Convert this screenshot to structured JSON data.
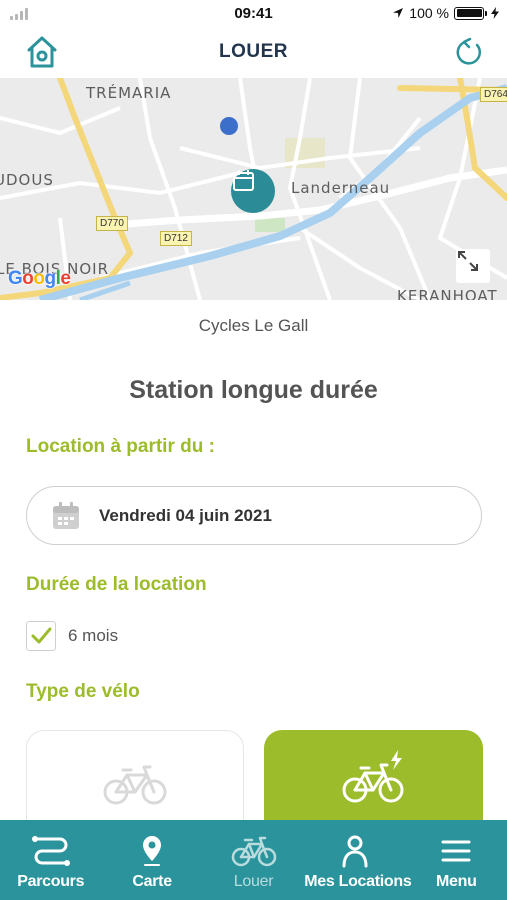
{
  "status_bar": {
    "time": "09:41",
    "battery": "100 %",
    "icons": [
      "signal-icon",
      "location-arrow-icon",
      "battery-icon",
      "charging-bolt-icon"
    ]
  },
  "header": {
    "title": "LOUER",
    "left_icon": "home-icon",
    "right_icon": "refresh-icon"
  },
  "map": {
    "labels": [
      "TRÉMARIA",
      "UDOUS",
      "Landerneau",
      "LE BOIS NOIR",
      "KERANHOAT"
    ],
    "road_tags": [
      "D770",
      "D712",
      "D764"
    ],
    "attribution": "Google",
    "marker_icon": "calendar-marker-icon",
    "expand_icon": "expand-icon"
  },
  "station": {
    "shop_name": "Cycles Le Gall",
    "title": "Station longue durée"
  },
  "form": {
    "start_label": "Location à partir du :",
    "start_date": "Vendredi 04 juin 2021",
    "duration_label": "Durée de la location",
    "duration_option": "6 mois",
    "duration_checked": true,
    "bike_type_label": "Type de vélo",
    "bike_types": [
      {
        "icon": "bike-icon",
        "selected": false
      },
      {
        "icon": "electric-bike-icon",
        "selected": true
      }
    ]
  },
  "tabs": [
    {
      "label": "Parcours",
      "icon": "route-icon",
      "active": false
    },
    {
      "label": "Carte",
      "icon": "map-pin-icon",
      "active": false
    },
    {
      "label": "Louer",
      "icon": "bike-icon",
      "active": true
    },
    {
      "label": "Mes Locations",
      "icon": "user-icon",
      "active": false
    },
    {
      "label": "Menu",
      "icon": "menu-icon",
      "active": false
    }
  ],
  "colors": {
    "teal": "#2b939b",
    "accent_green": "#9cbc2b",
    "title_navy": "#22354d"
  }
}
